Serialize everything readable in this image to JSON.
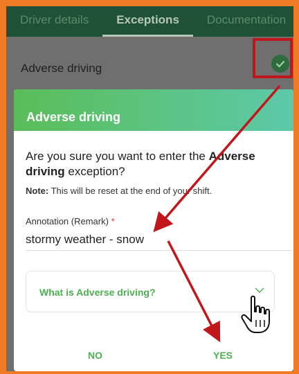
{
  "tabs": [
    {
      "label": "Driver details"
    },
    {
      "label": "Exceptions"
    },
    {
      "label": "Documentation"
    }
  ],
  "background_row": {
    "label": "Adverse driving"
  },
  "modal": {
    "title": "Adverse driving",
    "question_prefix": "Are you sure you want to enter the ",
    "question_bold": "Adverse driving",
    "question_suffix": " exception?",
    "note_prefix": "Note:",
    "note_text": " This will be reset at the end of your shift.",
    "annotation_label": "Annotation (Remark)",
    "required_mark": "*",
    "annotation_value": "stormy weather - snow",
    "faq_label": "What is Adverse driving?",
    "no_label": "NO",
    "yes_label": "YES"
  },
  "colors": {
    "accent": "#4caf50",
    "header_start": "#5bbd58",
    "header_end": "#5cc9a9",
    "annotation_arrow": "#c0161c",
    "frame_border": "#ee7a26"
  },
  "icons": [
    "check-icon",
    "chevron-down-icon",
    "hand-cursor-icon"
  ]
}
